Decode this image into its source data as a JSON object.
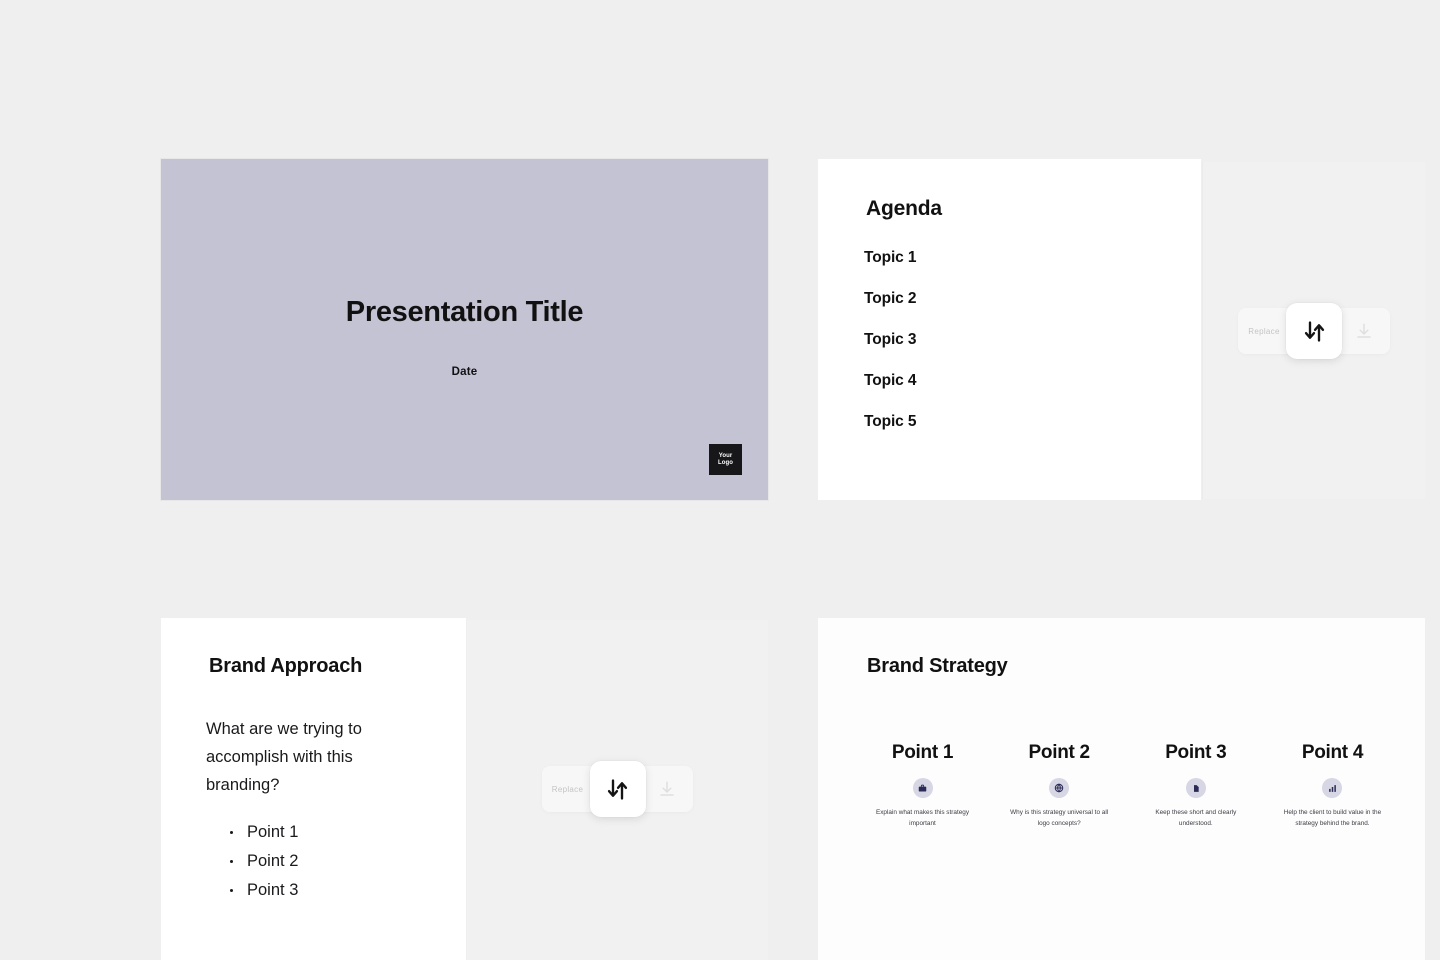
{
  "colors": {
    "page_background": "#efefef",
    "title_slide_background": "#c3c3d4",
    "slide_white": "#ffffff",
    "ghost_panel": "#f1f1f1",
    "logo_box": "#17171a",
    "text_primary": "#111112",
    "icon_circle": "#d6d6e4",
    "icon_glyph": "#2b2b55"
  },
  "slides": {
    "title_slide": {
      "name": "Presentation Title Slide",
      "title": "Presentation Title",
      "date": "Date",
      "logo": {
        "line1": "Your",
        "line2": "Logo"
      }
    },
    "agenda_slide": {
      "name": "Agenda Slide",
      "title": "Agenda",
      "topics": [
        "Topic 1",
        "Topic 2",
        "Topic 3",
        "Topic 4",
        "Topic 5"
      ]
    },
    "brand_approach_slide": {
      "name": "Brand Approach Slide",
      "title": "Brand Approach",
      "body": "What are we trying to accomplish with this branding?",
      "bullets": [
        "Point 1",
        "Point 2",
        "Point 3"
      ]
    },
    "brand_strategy_slide": {
      "name": "Brand Strategy Slide",
      "title": "Brand Strategy",
      "points": [
        {
          "heading": "Point 1",
          "icon": "briefcase-icon",
          "description": "Explain what makes this strategy important"
        },
        {
          "heading": "Point 2",
          "icon": "globe-icon",
          "description": "Why is this strategy universal to all logo concepts?"
        },
        {
          "heading": "Point 3",
          "icon": "document-icon",
          "description": "Keep these short and clearly understood."
        },
        {
          "heading": "Point 4",
          "icon": "chart-icon",
          "description": "Help the client to build value in the strategy behind the brand."
        }
      ]
    }
  },
  "overlays": {
    "agenda_overlay": {
      "swap_icon": "swap-vertical-icon",
      "left_label": "Replace",
      "download_icon": "download-icon"
    },
    "approach_overlay": {
      "swap_icon": "swap-vertical-icon",
      "left_label": "Replace",
      "download_icon": "download-icon"
    }
  }
}
